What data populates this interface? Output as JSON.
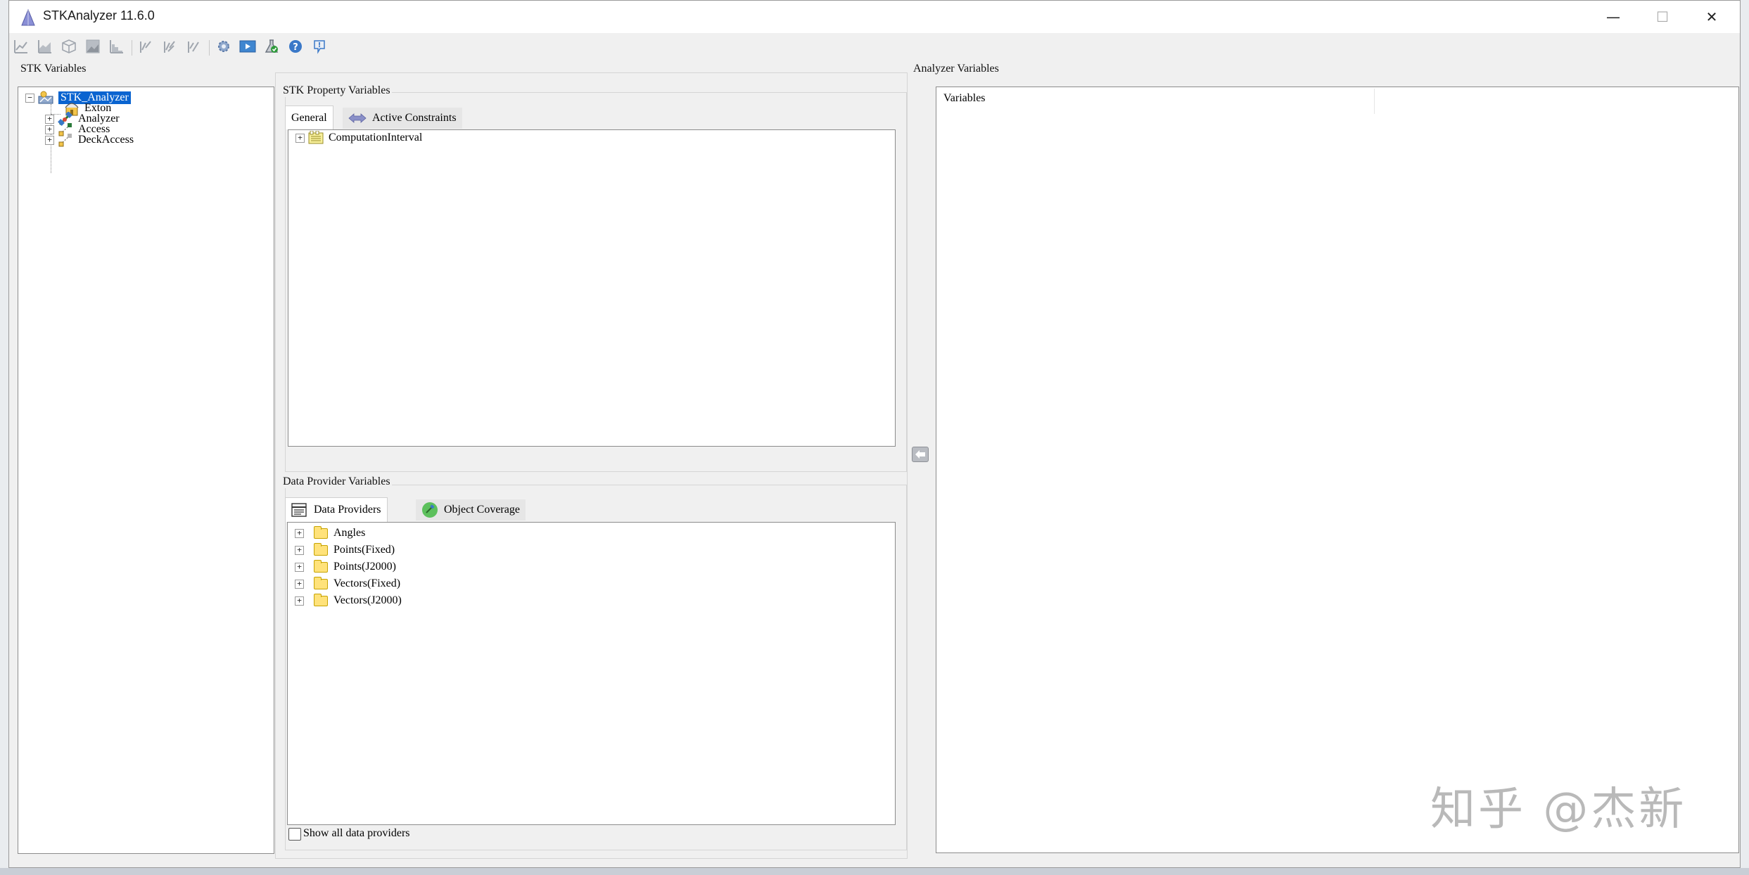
{
  "window": {
    "title": "STKAnalyzer 11.6.0",
    "controls": {
      "minimize": "—",
      "maximize": "☐",
      "close": "✕"
    }
  },
  "toolbar": {
    "icons": [
      "line-chart-icon",
      "area-chart-icon",
      "cube-icon",
      "image-icon",
      "histogram-icon",
      "scatter-icon",
      "multi-scatter-icon",
      "pareto-icon",
      "gear-icon",
      "play-screen-icon",
      "check-flask-icon",
      "help-icon",
      "info-icon"
    ]
  },
  "stk_variables": {
    "label": "STK Variables",
    "tree": [
      {
        "label": "STK_Analyzer",
        "icon": "scenario-icon",
        "expander": "−",
        "selected": true
      },
      {
        "label": "Exton",
        "icon": "facility-icon",
        "expander": ""
      },
      {
        "label": "Analyzer",
        "icon": "satellite-icon",
        "expander": "+"
      },
      {
        "label": "Access",
        "icon": "access-icon",
        "expander": "+"
      },
      {
        "label": "DeckAccess",
        "icon": "deck-access-icon",
        "expander": "+"
      }
    ]
  },
  "property_variables": {
    "label": "STK Property Variables",
    "tabs": [
      {
        "label": "General",
        "active": true
      },
      {
        "label": "Active Constraints",
        "active": false
      }
    ],
    "tree": [
      {
        "label": "ComputationInterval",
        "icon": "interval-icon",
        "expander": "+"
      }
    ]
  },
  "data_provider_variables": {
    "label": "Data Provider Variables",
    "tabs": [
      {
        "label": "Data Providers",
        "active": true
      },
      {
        "label": "Object Coverage",
        "active": false
      }
    ],
    "tree": [
      {
        "label": "Angles",
        "expander": "+"
      },
      {
        "label": "Points(Fixed)",
        "expander": "+"
      },
      {
        "label": "Points(J2000)",
        "expander": "+"
      },
      {
        "label": "Vectors(Fixed)",
        "expander": "+"
      },
      {
        "label": "Vectors(J2000)",
        "expander": "+"
      }
    ],
    "show_all_label": "Show all data providers",
    "show_all_checked": false
  },
  "analyzer_variables": {
    "label": "Analyzer Variables",
    "column_header": "Variables"
  },
  "watermark": "知乎 @杰新"
}
